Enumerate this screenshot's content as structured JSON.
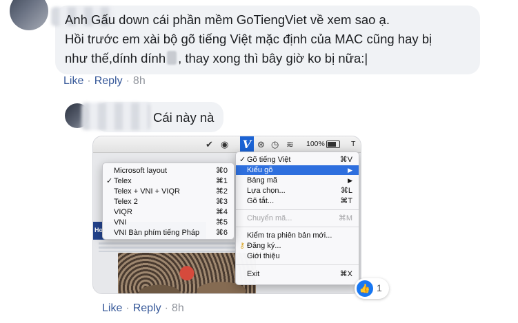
{
  "comments": [
    {
      "line1": "Anh Gấu down cái phần mềm GoTiengViet về xem sao ạ.",
      "line2": "Hồi trước em xài bộ gõ tiếng Việt mặc định của MAC cũng hay bị",
      "line3a": "như thế,dính dính",
      "line3b": ", thay xong thì bây giờ ko bị nữa:|",
      "like": "Like",
      "reply": "Reply",
      "time": "8h"
    },
    {
      "text": "Cái này nà",
      "like": "Like",
      "reply": "Reply",
      "time": "8h",
      "reaction_count": "1"
    }
  ],
  "screenshot": {
    "menubar": {
      "battery": "100%",
      "edge": "T",
      "input_icon": "V"
    },
    "main_menu": [
      {
        "label": "Gõ tiếng Việt",
        "shortcut": "⌘V",
        "checked": true
      },
      {
        "label": "Kiểu gõ",
        "arrow": "▶",
        "selected": true
      },
      {
        "label": "Bảng mã",
        "arrow": "▶"
      },
      {
        "label": "Lựa chọn...",
        "shortcut": "⌘L"
      },
      {
        "label": "Gõ tắt...",
        "shortcut": "⌘T"
      },
      {
        "label": "Chuyển mã...",
        "shortcut": "⌘M",
        "disabled": true
      },
      {
        "label": "Kiểm tra phiên bản mới..."
      },
      {
        "label": "Đăng ký..."
      },
      {
        "label": "Giới thiệu"
      },
      {
        "label": "Exit",
        "shortcut": "⌘X"
      }
    ],
    "sub_menu": [
      {
        "label": "Microsoft layout",
        "shortcut": "⌘0"
      },
      {
        "label": "Telex",
        "shortcut": "⌘1",
        "checked": true
      },
      {
        "label": "Telex + VNI + VIQR",
        "shortcut": "⌘2"
      },
      {
        "label": "Telex 2",
        "shortcut": "⌘3"
      },
      {
        "label": "VIQR",
        "shortcut": "⌘4"
      },
      {
        "label": "VNI",
        "shortcut": "⌘5"
      },
      {
        "label": "VNI Bàn phím tiếng Pháp",
        "shortcut": "⌘6"
      }
    ],
    "page_fragment": "Ho"
  },
  "colors": {
    "link": "#365899",
    "bubble": "#f0f2f5",
    "highlight": "#2e6fde",
    "like": "#1877f2"
  },
  "icons": [
    "like-icon",
    "wifi-icon",
    "bluetooth-icon",
    "checkmark-icon",
    "battery-icon"
  ]
}
